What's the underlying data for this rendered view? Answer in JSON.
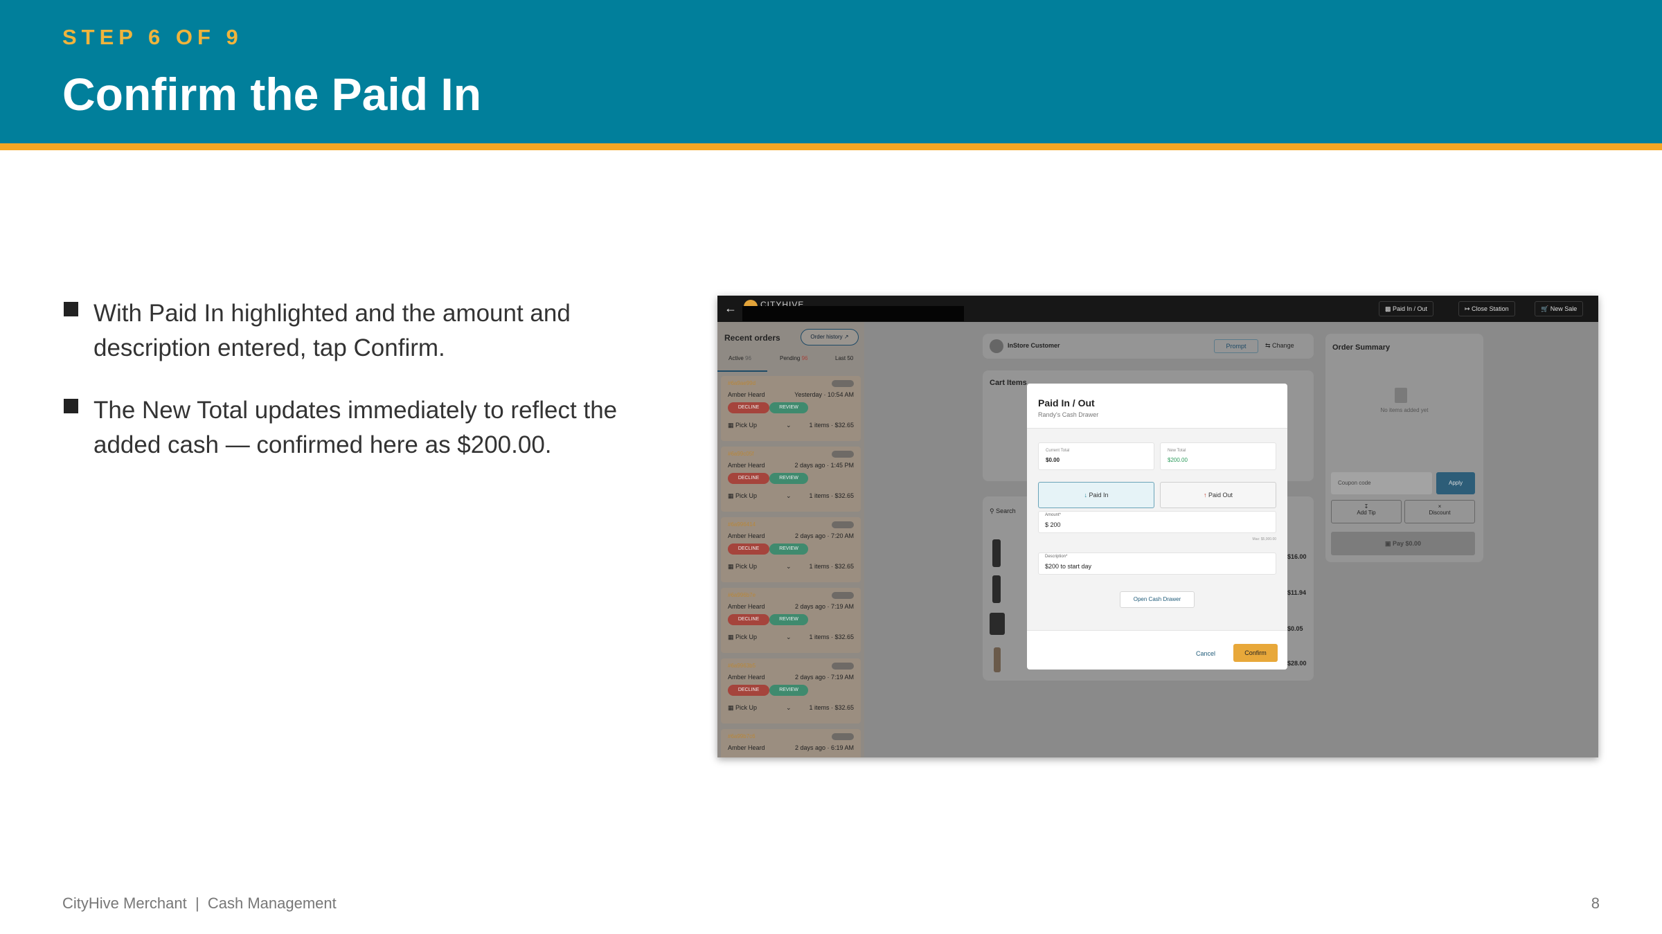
{
  "slide": {
    "step": "STEP 6 OF 9",
    "title": "Confirm the Paid In",
    "bullets": [
      "With Paid In highlighted and the amount and description entered, tap Confirm.",
      "The New Total updates immediately to reflect the added cash — confirmed here as $200.00."
    ],
    "footer": "CityHive Merchant  |  Cash Management",
    "page_number": "8"
  },
  "colors": {
    "header": "#017f9b",
    "accent_line": "#f5a623",
    "step_text": "#f0b43c",
    "confirm": "#e8a83a"
  },
  "screenshot": {
    "topbar": {
      "brand": "CITYHIVE",
      "buttons": [
        "Paid In / Out",
        "Close Station",
        "New Sale"
      ]
    },
    "sidebar": {
      "title": "Recent orders",
      "order_history": "Order history",
      "tabs": [
        "Active",
        "Pending",
        "Last 50"
      ],
      "tab_counts": [
        "96",
        "96"
      ],
      "orders": [
        {
          "id": "#6a9ae99d",
          "name": "Amber Heard",
          "when": "Yesterday · 10:54 AM",
          "decline": "DECLINE",
          "review": "REVIEW",
          "type": "Pick Up",
          "total": "1 items · $32.65"
        },
        {
          "id": "#6a99c05f",
          "name": "Amber Heard",
          "when": "2 days ago · 1:45 PM",
          "decline": "DECLINE",
          "review": "REVIEW",
          "type": "Pick Up",
          "total": "1 items · $32.65"
        },
        {
          "id": "#6a996414",
          "name": "Amber Heard",
          "when": "2 days ago · 7:20 AM",
          "decline": "DECLINE",
          "review": "REVIEW",
          "type": "Pick Up",
          "total": "1 items · $32.65"
        },
        {
          "id": "#6a996b7e",
          "name": "Amber Heard",
          "when": "2 days ago · 7:19 AM",
          "decline": "DECLINE",
          "review": "REVIEW",
          "type": "Pick Up",
          "total": "1 items · $32.65"
        },
        {
          "id": "#6a9963b5",
          "name": "Amber Heard",
          "when": "2 days ago · 7:19 AM",
          "decline": "DECLINE",
          "review": "REVIEW",
          "type": "Pick Up",
          "total": "1 items · $32.65"
        },
        {
          "id": "#6a99b7c6",
          "name": "Amber Heard",
          "when": "2 days ago · 6:19 AM",
          "decline": "",
          "review": "",
          "type": "",
          "total": ""
        }
      ]
    },
    "customer": {
      "name": "InStore Customer",
      "prompt": "Prompt",
      "change": "Change"
    },
    "cart": {
      "title": "Cart Items",
      "search": "Search",
      "prices": [
        "$16.00",
        "$11.94",
        "$0.05",
        "$28.00"
      ]
    },
    "summary": {
      "title": "Order Summary",
      "empty": "No items added yet",
      "coupon_placeholder": "Coupon code",
      "apply": "Apply",
      "add_tip": "Add Tip",
      "discount": "Discount",
      "pay": "Pay $0.00"
    },
    "modal": {
      "title": "Paid In / Out",
      "subtitle": "Randy's Cash Drawer",
      "current_total_label": "Current Total",
      "current_total": "$0.00",
      "new_total_label": "New Total",
      "new_total": "$200.00",
      "paid_in": "Paid In",
      "paid_out": "Paid Out",
      "amount_label": "Amount*",
      "amount": "$ 200",
      "max": "Max: $5,000.00",
      "description_label": "Description*",
      "description": "$200 to start day",
      "open_drawer": "Open Cash Drawer",
      "cancel": "Cancel",
      "confirm": "Confirm"
    }
  }
}
